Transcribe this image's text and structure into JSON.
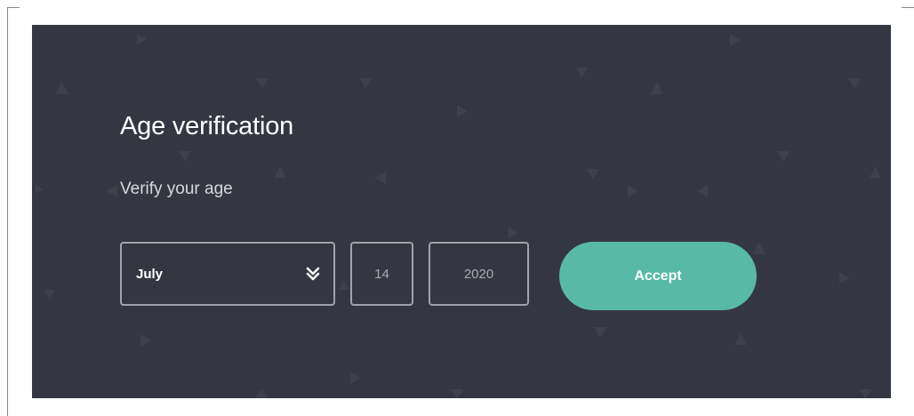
{
  "modal": {
    "title": "Age verification",
    "subtitle": "Verify your age",
    "background_color": "#343741",
    "accent_color": "#57b9a6"
  },
  "form": {
    "month": {
      "selected": "July",
      "icon": "double-chevron-down-icon"
    },
    "day": {
      "value": "14"
    },
    "year": {
      "value": "2020"
    },
    "accept_label": "Accept"
  }
}
